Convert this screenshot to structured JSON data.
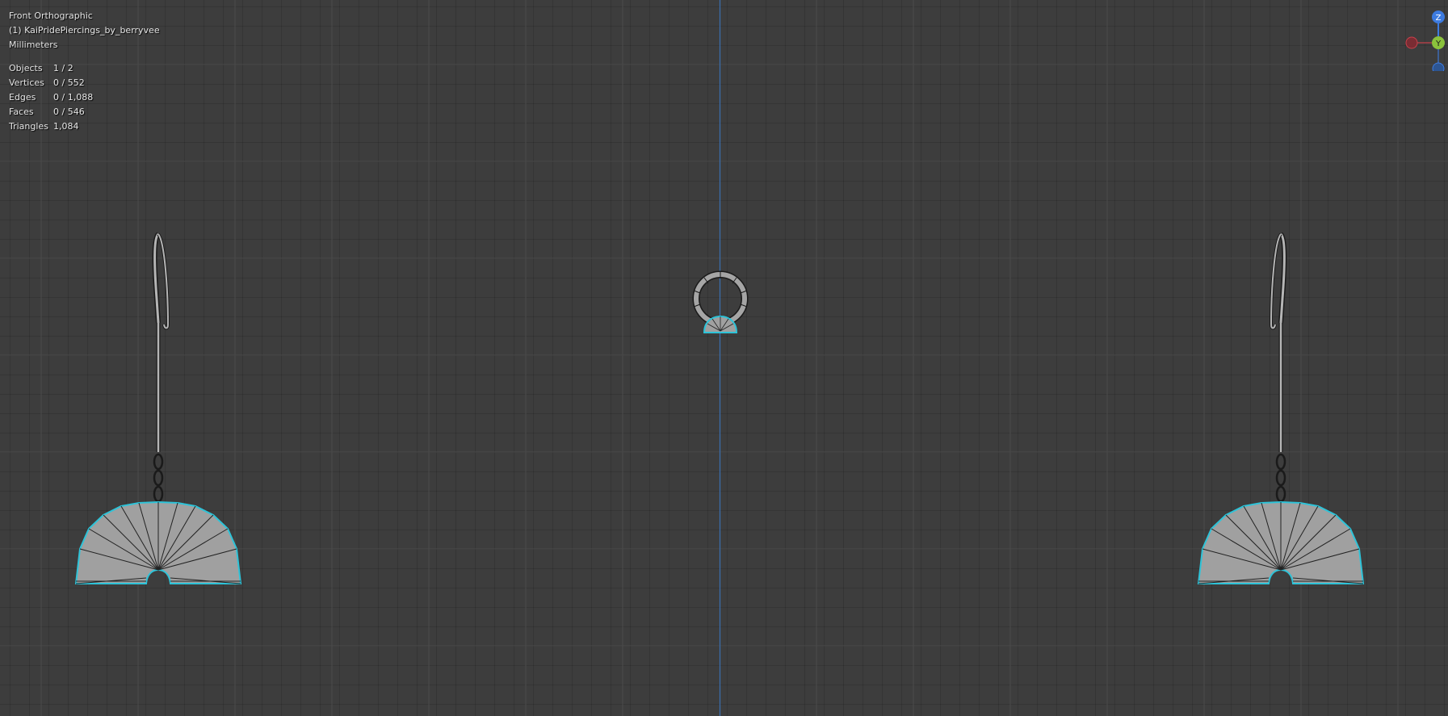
{
  "viewport": {
    "view_name": "Front Orthographic",
    "collection_name": "(1) KaiPridePiercings_by_berryvee",
    "units": "Millimeters"
  },
  "stats": [
    {
      "label": "Objects",
      "value": "1 / 2"
    },
    {
      "label": "Vertices",
      "value": "0 / 552"
    },
    {
      "label": "Edges",
      "value": "0 / 1,088"
    },
    {
      "label": "Faces",
      "value": "0 / 546"
    },
    {
      "label": "Triangles",
      "value": "1,084"
    }
  ],
  "gizmo": {
    "z_label": "Z",
    "y_label": "Y",
    "colors": {
      "x": "#c9414b",
      "y": "#8bc23c",
      "z": "#3d7be0"
    }
  },
  "colors": {
    "background": "#3d3d3d",
    "grid_major": "#4b4b4b",
    "selection_outline": "#2ec3d8",
    "mesh_fill": "#a0a0a0",
    "vertical_axis": "#3b6fb0"
  }
}
